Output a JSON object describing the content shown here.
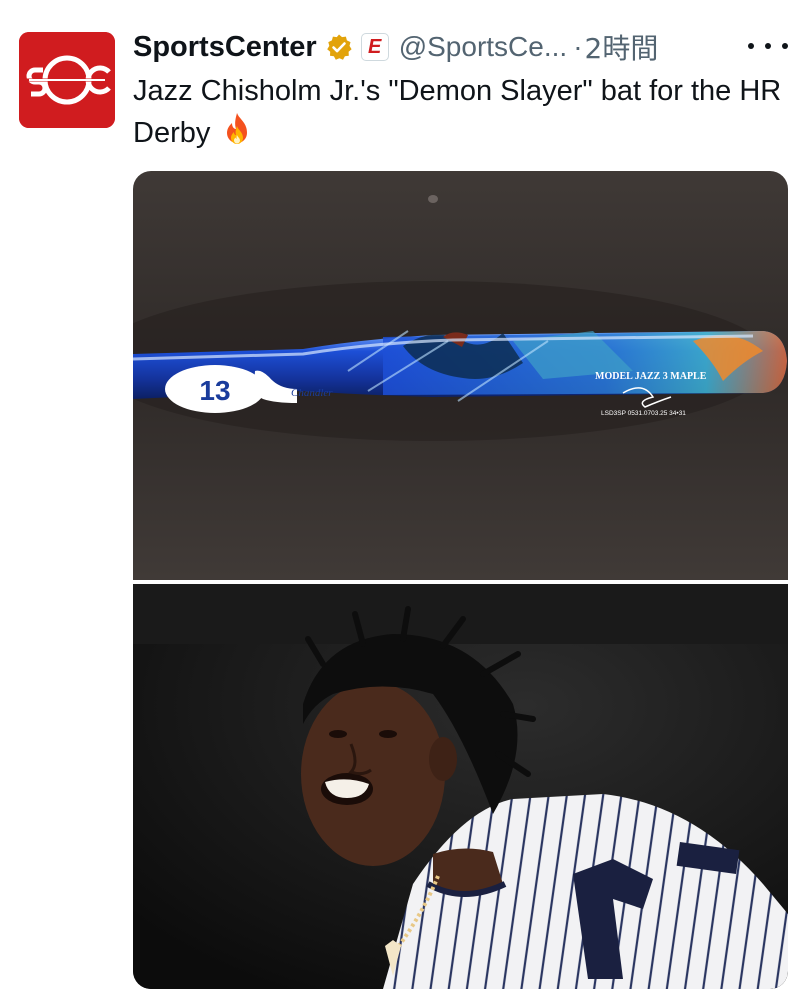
{
  "account": {
    "name": "SportsCenter",
    "handle": "@SportsCe...",
    "separator": "·",
    "time": "2時間",
    "avatar_icon": "sportscenter-logo-icon",
    "verified_icon": "verified-badge-icon",
    "affiliate_badge_letter": "E"
  },
  "tweet": {
    "text": "Jazz Chisholm Jr.'s \"Demon Slayer\" bat for the HR Derby",
    "emoji_icon": "fire-icon"
  },
  "media": {
    "bat_number": "13",
    "bat_signature": "Chandler",
    "bat_model": "MODEL JAZZ 3 MAPLE",
    "bat_code": "LSD3SP 0531.0703.25 34•31"
  },
  "colors": {
    "brand_red": "#d01c1f",
    "verified_gold": "#e2a30b",
    "handle_gray": "#536471"
  }
}
